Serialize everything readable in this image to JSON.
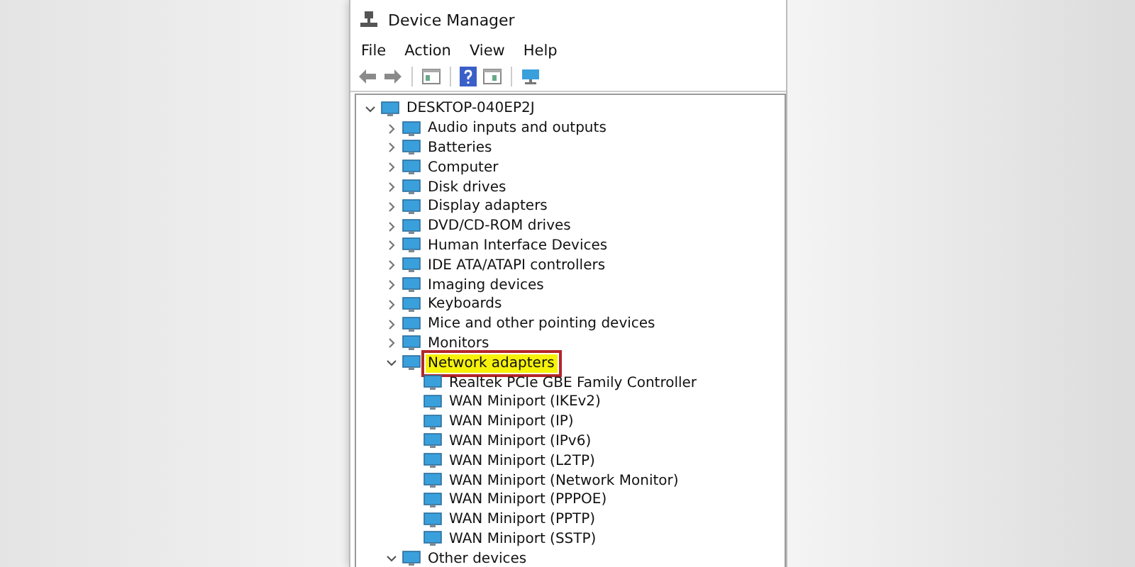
{
  "window": {
    "title": "Device Manager"
  },
  "menu": [
    "File",
    "Action",
    "View",
    "Help"
  ],
  "tree": {
    "label": "DESKTOP-040EP2J",
    "expanded": true,
    "children": [
      {
        "label": "Audio inputs and outputs",
        "expanded": false,
        "highlighted": false
      },
      {
        "label": "Batteries",
        "expanded": false,
        "highlighted": false
      },
      {
        "label": "Computer",
        "expanded": false,
        "highlighted": false
      },
      {
        "label": "Disk drives",
        "expanded": false,
        "highlighted": false
      },
      {
        "label": "Display adapters",
        "expanded": false,
        "highlighted": false
      },
      {
        "label": "DVD/CD-ROM drives",
        "expanded": false,
        "highlighted": false
      },
      {
        "label": "Human Interface Devices",
        "expanded": false,
        "highlighted": false
      },
      {
        "label": "IDE ATA/ATAPI controllers",
        "expanded": false,
        "highlighted": false
      },
      {
        "label": "Imaging devices",
        "expanded": false,
        "highlighted": false
      },
      {
        "label": "Keyboards",
        "expanded": false,
        "highlighted": false
      },
      {
        "label": "Mice and other pointing devices",
        "expanded": false,
        "highlighted": false
      },
      {
        "label": "Monitors",
        "expanded": false,
        "highlighted": false
      },
      {
        "label": "Network adapters",
        "expanded": true,
        "highlighted": true,
        "children": [
          {
            "label": "Realtek PCIe GBE Family Controller"
          },
          {
            "label": "WAN Miniport (IKEv2)"
          },
          {
            "label": "WAN Miniport (IP)"
          },
          {
            "label": "WAN Miniport (IPv6)"
          },
          {
            "label": "WAN Miniport (L2TP)"
          },
          {
            "label": "WAN Miniport (Network Monitor)"
          },
          {
            "label": "WAN Miniport (PPPOE)"
          },
          {
            "label": "WAN Miniport (PPTP)"
          },
          {
            "label": "WAN Miniport (SSTP)"
          }
        ]
      },
      {
        "label": "Other devices",
        "expanded": true,
        "highlighted": false
      }
    ]
  }
}
